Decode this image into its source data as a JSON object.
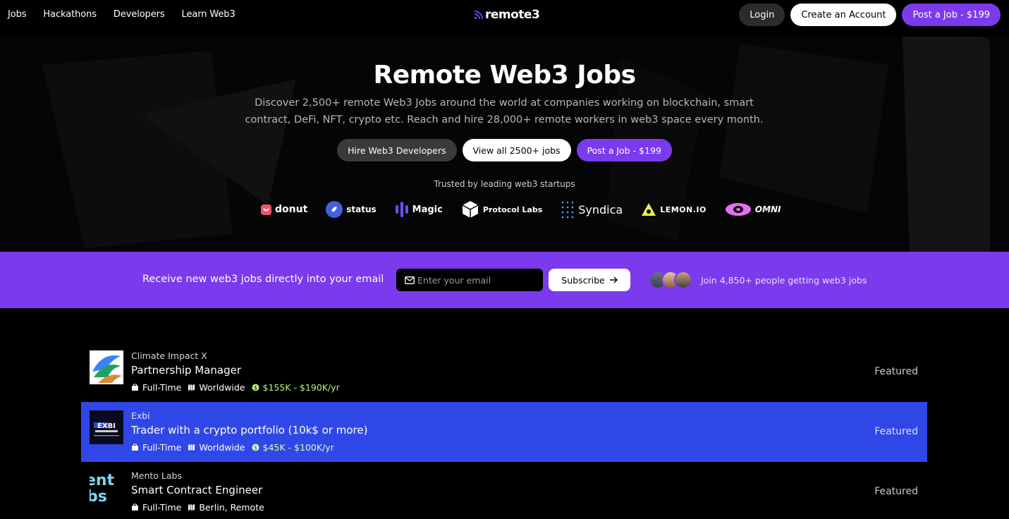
{
  "nav": {
    "links": [
      "Jobs",
      "Hackathons",
      "Developers",
      "Learn Web3"
    ],
    "logo": "remote3",
    "login": "Login",
    "create_account": "Create an Account",
    "post_job": "Post a Job - $199"
  },
  "hero": {
    "title": "Remote Web3 Jobs",
    "subtitle": "Discover 2,500+ remote Web3 Jobs around the world at companies working on blockchain, smart contract, DeFi, NFT, crypto etc. Reach and hire 28,000+ remote workers in web3 space every month.",
    "btn_hire": "Hire Web3 Developers",
    "btn_view": "View all 2500+ jobs",
    "btn_post": "Post a Job - $199",
    "trusted": "Trusted by leading web3 startups",
    "brands": [
      "donut",
      "status",
      "Magic",
      "Protocol Labs",
      "Syndica",
      "LEMON.IO",
      "OMNI"
    ]
  },
  "newsletter": {
    "text": "Receive new web3 jobs directly into your email",
    "placeholder": "Enter your email",
    "subscribe": "Subscribe",
    "join": "Join 4,850+ people getting web3 jobs"
  },
  "jobs": [
    {
      "company": "Climate Impact X",
      "title": "Partnership Manager",
      "type": "Full-Time",
      "location": "Worldwide",
      "salary": "$155K - $190K/yr",
      "badge": "Featured"
    },
    {
      "company": "Exbi",
      "title": "Trader with a crypto portfolio (10k$ or more)",
      "type": "Full-Time",
      "location": "Worldwide",
      "salary": "$45K - $100K/yr",
      "badge": "Featured"
    },
    {
      "company": "Mento Labs",
      "title": "Smart Contract Engineer",
      "type": "Full-Time",
      "location": "Berlin, Remote",
      "badge": "Featured"
    }
  ],
  "colors": {
    "accent": "#7c3aed",
    "highlight_row": "#3047e8",
    "salary": "#b6f36b"
  }
}
